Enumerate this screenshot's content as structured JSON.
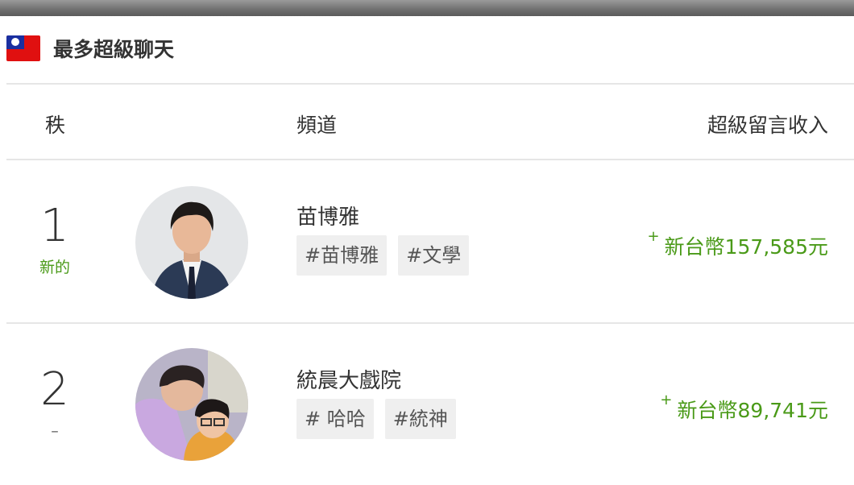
{
  "header": {
    "title": "最多超級聊天",
    "flag_icon": "taiwan-flag-icon"
  },
  "columns": {
    "rank": "秩",
    "channel": "頻道",
    "income": "超級留言收入"
  },
  "rows": [
    {
      "rank": "1",
      "change": "新的",
      "change_color": "#4a9a18",
      "channel": "苗博雅",
      "tags": [
        "#苗博雅",
        "#文學"
      ],
      "plus": "+",
      "amount": "新台幣157,585元"
    },
    {
      "rank": "2",
      "change": "–",
      "change_color": "#666666",
      "channel": "統晨大戲院",
      "tags": [
        "# 哈哈",
        "#統神"
      ],
      "plus": "+",
      "amount": "新台幣89,741元"
    }
  ],
  "colors": {
    "accent_green": "#4a9a18",
    "tag_bg": "#efefef",
    "divider": "#e6e6e6"
  }
}
